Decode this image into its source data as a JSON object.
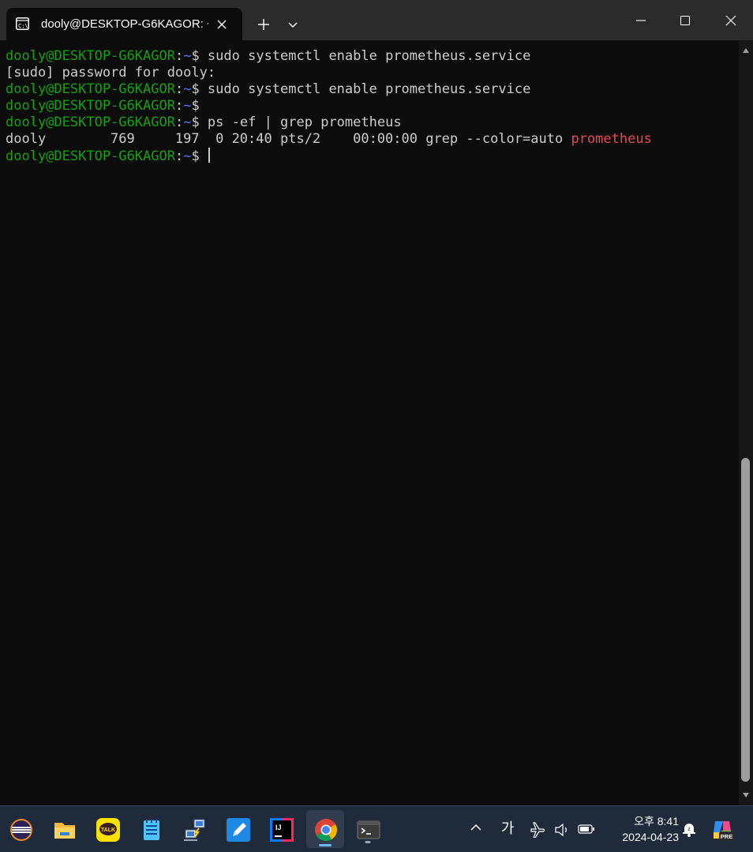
{
  "window": {
    "tab_title": "dooly@DESKTOP-G6KAGOR: ~",
    "buttons": {
      "new_tab_icon": "plus-icon",
      "dropdown_icon": "chevron-down-icon",
      "minimize_icon": "minimize-icon",
      "maximize_icon": "maximize-icon",
      "close_icon": "close-icon"
    }
  },
  "terminal": {
    "colors": {
      "background": "#0c0c0c",
      "foreground": "#cccccc",
      "user_host": "#13a10e",
      "path": "#3b78ff",
      "grep_match": "#e74856"
    },
    "prompt": {
      "user_host": "dooly@DESKTOP-G6KAGOR",
      "separator": ":",
      "path": "~",
      "symbol": "$"
    },
    "lines": [
      {
        "type": "prompt",
        "command": " sudo systemctl enable prometheus.service"
      },
      {
        "type": "output",
        "text": "[sudo] password for dooly:"
      },
      {
        "type": "prompt",
        "command": " sudo systemctl enable prometheus.service"
      },
      {
        "type": "prompt",
        "command": ""
      },
      {
        "type": "prompt",
        "command": " ps -ef | grep prometheus"
      },
      {
        "type": "output_match",
        "text": "dooly        769     197  0 20:40 pts/2    00:00:00 grep --color=auto ",
        "match": "prometheus"
      },
      {
        "type": "prompt_cursor",
        "command": " "
      }
    ]
  },
  "taskbar": {
    "apps": [
      {
        "name": "eclipse-icon"
      },
      {
        "name": "file-explorer-icon"
      },
      {
        "name": "kakaotalk-icon",
        "label": "TALK"
      },
      {
        "name": "notepad-icon"
      },
      {
        "name": "network-tool-icon"
      },
      {
        "name": "pen-app-icon"
      },
      {
        "name": "intellij-idea-icon",
        "label": "IJ"
      },
      {
        "name": "chrome-icon",
        "active": true
      },
      {
        "name": "terminal-icon",
        "running": true
      }
    ],
    "tray": {
      "ime_label": "가",
      "time": "오후 8:41",
      "date": "2024-04-23",
      "copilot_badge": "PRE"
    }
  }
}
